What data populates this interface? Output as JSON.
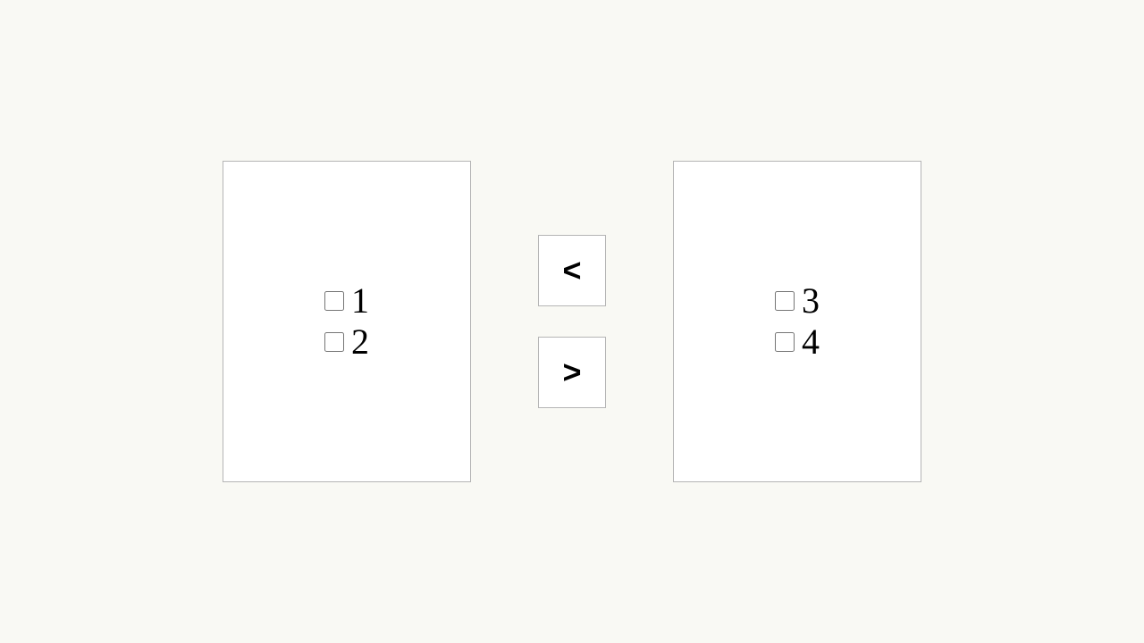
{
  "left_panel": {
    "items": [
      "1",
      "2"
    ]
  },
  "buttons": {
    "move_left": "<",
    "move_right": ">"
  },
  "right_panel": {
    "items": [
      "3",
      "4"
    ]
  }
}
